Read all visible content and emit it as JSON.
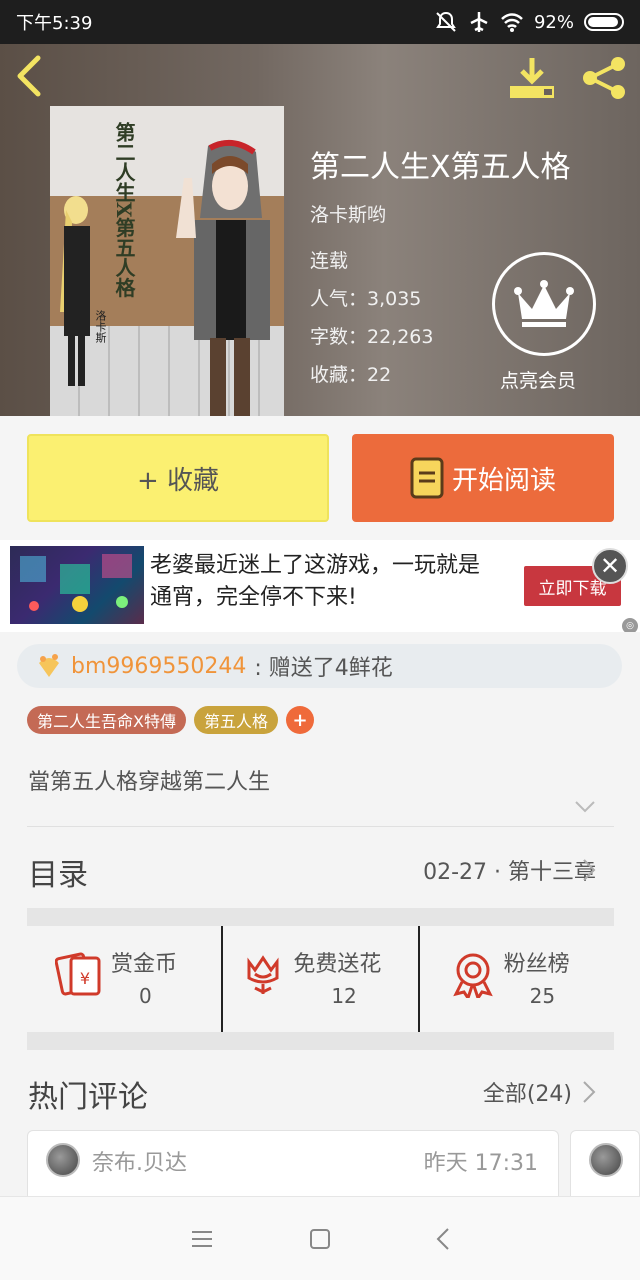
{
  "status_bar": {
    "time": "下午5:39",
    "battery": "92%"
  },
  "header": {
    "back_icon": "chevron-left-icon",
    "download_icon": "download-icon",
    "share_icon": "share-icon",
    "accent": "#f3e462"
  },
  "book": {
    "title": "第二人生X第五人格",
    "author": "洛卡斯哟",
    "status": "连载",
    "popularity": "人气：3,035",
    "word_count": "字数：22,263",
    "favorites": "收藏：22",
    "cover_title": "第二人生X第五人格",
    "cover_author": "洛卡斯"
  },
  "vip": {
    "label": "点亮会员",
    "icon": "crown-icon"
  },
  "actions": {
    "favorite": "+ 收藏",
    "read": "开始阅读",
    "favorite_color": "#fbf071",
    "read_color": "#ec6b3c"
  },
  "ad": {
    "text": "老婆最近迷上了这游戏，一玩就是通宵，完全停不下来!",
    "button": "立即下载"
  },
  "gift": {
    "user": "bm9969550244",
    "message": ": 赠送了4鲜花"
  },
  "tags": [
    "第二人生吾命X特傳",
    "第五人格",
    "+"
  ],
  "synopsis": "當第五人格穿越第二人生",
  "toc": {
    "label": "目录",
    "latest": "02-27 · 第十三章"
  },
  "rewards": [
    {
      "label": "赏金币",
      "value": "0",
      "icon": "red-envelope-icon"
    },
    {
      "label": "免费送花",
      "value": "12",
      "icon": "flower-icon"
    },
    {
      "label": "粉丝榜",
      "value": "25",
      "icon": "rosette-icon"
    }
  ],
  "comments": {
    "label": "热门评论",
    "all": "全部(24)",
    "first": {
      "user": "奈布.贝达",
      "time": "昨天 17:31"
    }
  }
}
